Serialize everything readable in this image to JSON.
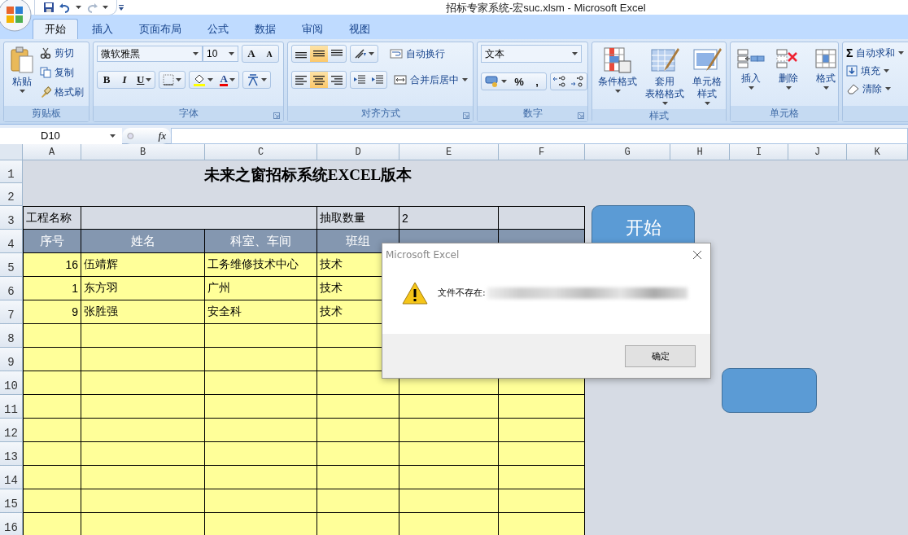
{
  "window": {
    "title": "招标专家系统-宏suc.xlsm - Microsoft Excel"
  },
  "tabs": [
    {
      "label": "开始",
      "selected": true
    },
    {
      "label": "插入",
      "selected": false
    },
    {
      "label": "页面布局",
      "selected": false
    },
    {
      "label": "公式",
      "selected": false
    },
    {
      "label": "数据",
      "selected": false
    },
    {
      "label": "审阅",
      "selected": false
    },
    {
      "label": "视图",
      "selected": false
    }
  ],
  "ribbon": {
    "clipboard": {
      "label": "剪贴板",
      "paste": "粘贴",
      "items": [
        "剪切",
        "复制",
        "格式刷"
      ]
    },
    "font": {
      "label": "字体",
      "family": "微软雅黑",
      "size": "10",
      "grow": "A",
      "shrink": "A",
      "bold": "B",
      "italic": "I",
      "underline": "U",
      "font_color": "A"
    },
    "alignment": {
      "label": "对齐方式",
      "vertical": [
        {
          "selected": false
        },
        {
          "selected": true
        },
        {
          "selected": false
        }
      ],
      "horizontal": [
        {
          "selected": false
        },
        {
          "selected": true
        },
        {
          "selected": false
        }
      ],
      "wrap": "自动换行",
      "merge": "合并后居中"
    },
    "number": {
      "label": "数字",
      "format": "文本",
      "percent": "%",
      "comma": ","
    },
    "styles": {
      "label": "样式",
      "buttons": [
        {
          "lines": [
            "条件格式"
          ]
        },
        {
          "lines": [
            "套用",
            "表格格式"
          ]
        },
        {
          "lines": [
            "单元格",
            "样式"
          ]
        }
      ]
    },
    "cells": {
      "label": "单元格",
      "buttons": [
        "插入",
        "删除",
        "格式"
      ]
    },
    "editing": {
      "sigma": "Σ",
      "items": [
        "自动求和",
        "填充",
        "清除"
      ]
    }
  },
  "name_box": "D10",
  "formula_icon": "fx",
  "columns": [
    "A",
    "B",
    "C",
    "D",
    "E",
    "F",
    "G",
    "H",
    "I",
    "J",
    "K"
  ],
  "rows": [
    "1",
    "2",
    "3",
    "4",
    "5",
    "6",
    "7",
    "8",
    "9",
    "10",
    "11",
    "12",
    "13",
    "14",
    "15",
    "16"
  ],
  "sheet": {
    "title": "未来之窗招标系统EXCEL版本",
    "info": {
      "project_label": "工程名称",
      "count_label": "抽取数量",
      "count": "2"
    },
    "headers": [
      "序号",
      "姓名",
      "科室、车间",
      "班组"
    ],
    "records": [
      [
        "16",
        "伍靖辉",
        "工务维修技术中心",
        "技术"
      ],
      [
        "1",
        "东方羽",
        "广州",
        "技术"
      ],
      [
        "9",
        "张胜强",
        "安全科",
        "技术"
      ]
    ]
  },
  "shapes": [
    {
      "label": "开始"
    }
  ],
  "dialog": {
    "title": "Microsoft Excel",
    "message": "文件不存在:",
    "button": "确定"
  }
}
